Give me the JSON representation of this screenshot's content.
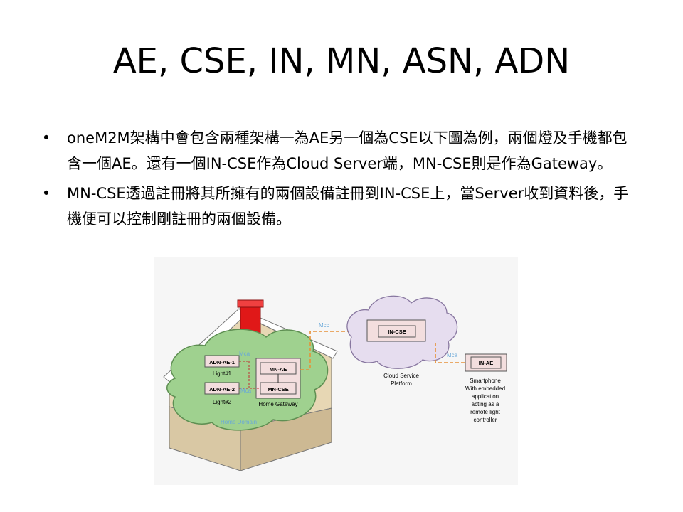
{
  "slide": {
    "title": "AE, CSE, IN, MN, ASN, ADN",
    "bullets": [
      "oneM2M架構中會包含兩種架構一為AE另一個為CSE以下圖為例，兩個燈及手機都包含一個AE。還有一個IN-CSE作為Cloud Server端，MN-CSE則是作為Gateway。",
      "MN-CSE透過註冊將其所擁有的兩個設備註冊到IN-CSE上，當Server收到資料後，手機便可以控制剛註冊的兩個設備。"
    ]
  },
  "diagram": {
    "adn_ae_1": "ADN-AE-1",
    "light1": "Light#1",
    "adn_ae_2": "ADN-AE-2",
    "light2": "Light#2",
    "mn_ae": "MN-AE",
    "mn_cse": "MN-CSE",
    "home_gateway": "Home Gateway",
    "home_domain": "Home Domain",
    "mca_upper": "Mca",
    "mca_lower": "Mca",
    "mcc": "Mcc",
    "in_cse": "IN-CSE",
    "cloud_line1": "Cloud Service",
    "cloud_line2": "Platform",
    "mca_right": "Mca",
    "in_ae": "IN-AE",
    "phone_lines": [
      "Smartphone",
      "With embedded",
      "application",
      "acting as a",
      "remote light",
      "controller"
    ]
  },
  "colors": {
    "cloud_green": "#9fd18f",
    "cloud_purple": "#e6ddef",
    "box_fill": "#f3dede",
    "mca_blue": "#6aa8d8",
    "link_orange": "#e69138",
    "chimney_red": "#e01818"
  }
}
